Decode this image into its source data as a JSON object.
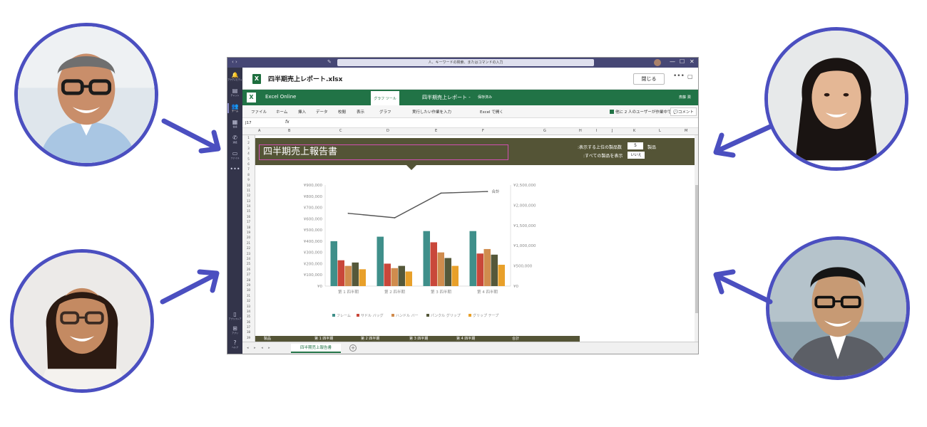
{
  "colors": {
    "teams_purple": "#464775",
    "excel_green": "#217346",
    "banner": "#545436",
    "ring": "#4b4fc0"
  },
  "titlebar": {
    "search_placeholder": "人、キーワードの検索、またはコマンドの入力",
    "nav": "‹ ›",
    "compose": "✎",
    "min": "—",
    "max": "☐",
    "close": "✕"
  },
  "rail": [
    {
      "icon": "bell-icon",
      "glyph": "🔔",
      "label": "アクティビティ"
    },
    {
      "icon": "chat-icon",
      "glyph": "▤",
      "label": "チャット"
    },
    {
      "icon": "teams-icon",
      "glyph": "👥",
      "label": "チーム",
      "active": true
    },
    {
      "icon": "calendar-icon",
      "glyph": "▦",
      "label": "会議"
    },
    {
      "icon": "phone-icon",
      "glyph": "✆",
      "label": "通話"
    },
    {
      "icon": "file-icon",
      "glyph": "▭",
      "label": "ファイル"
    },
    {
      "icon": "more-icon",
      "glyph": "•••",
      "label": ""
    }
  ],
  "rail_bottom": [
    {
      "icon": "store-icon",
      "glyph": "▯",
      "label": "アプリストア"
    },
    {
      "icon": "apps-icon",
      "glyph": "⊞",
      "label": "アプリ"
    },
    {
      "icon": "help-icon",
      "glyph": "?",
      "label": "ヘルプ"
    }
  ],
  "file": {
    "name": "四半期売上レポート.xlsx",
    "close_label": "閉じる",
    "more": "•••",
    "chat": "▢"
  },
  "excel_bar": {
    "icon": "X",
    "brand": "Excel Online",
    "chart_tools": "グラフ ツール",
    "doc_title": "四半期売上レポート  -",
    "saved": "保存済み",
    "user": "斎藤 潤"
  },
  "ribbon": {
    "tabs": [
      "ファイル",
      "ホーム",
      "挿入",
      "データ",
      "校閲",
      "表示",
      "グラフ"
    ],
    "tell_me": "実行したい作業を入力",
    "open_excel": "Excel で開く",
    "coedit": "他に 2 人のユーザーが作業中です ▾",
    "comment": "💬コメント"
  },
  "formula": {
    "cellref": "J17",
    "fx": "fx"
  },
  "columns": [
    "A",
    "B",
    "C",
    "D",
    "E",
    "F",
    "G",
    "H",
    "I",
    "J",
    "K",
    "L",
    "M"
  ],
  "rows": [
    "1",
    "2",
    "3",
    "4",
    "5",
    "6",
    "7",
    "8",
    "9",
    "10",
    "11",
    "12",
    "13",
    "14",
    "15",
    "16",
    "17",
    "18",
    "19",
    "20",
    "21",
    "22",
    "23",
    "24",
    "25",
    "26",
    "27",
    "28",
    "29",
    "30",
    "31",
    "32",
    "33",
    "34",
    "35",
    "36",
    "37",
    "38",
    "39"
  ],
  "report": {
    "title": "四半期売上報告書",
    "top_label": ":表示する上位の製品数",
    "top_value": "5",
    "top_unit": "製品",
    "all_label": ":すべての製品を表示",
    "all_value": "いいえ"
  },
  "chart_data": {
    "type": "bar",
    "categories": [
      "第 1 四半期",
      "第 2 四半期",
      "第 3 四半期",
      "第 4 四半期"
    ],
    "series": [
      {
        "name": "フレーム",
        "color": "#3f8f8a",
        "values": [
          400000,
          440000,
          490000,
          490000
        ]
      },
      {
        "name": "サドル バッグ",
        "color": "#c9473a",
        "values": [
          230000,
          200000,
          390000,
          290000
        ]
      },
      {
        "name": "ハンドル バー",
        "color": "#d08c4e",
        "values": [
          180000,
          160000,
          300000,
          330000
        ]
      },
      {
        "name": "パンクル グリップ",
        "color": "#55583a",
        "values": [
          210000,
          180000,
          250000,
          280000
        ]
      },
      {
        "name": "グリップ テープ",
        "color": "#e8a02a",
        "values": [
          150000,
          130000,
          180000,
          190000
        ]
      }
    ],
    "line": {
      "name": "合計",
      "values": [
        1800000,
        1690000,
        2300000,
        2340000
      ]
    },
    "yticks_left": [
      "¥900,000",
      "¥800,000",
      "¥700,000",
      "¥600,000",
      "¥500,000",
      "¥400,000",
      "¥300,000",
      "¥200,000",
      "¥100,000",
      "¥0"
    ],
    "yticks_right": [
      "¥2,500,000",
      "¥2,000,000",
      "¥1,500,000",
      "¥1,000,000",
      "¥500,000",
      "¥0"
    ],
    "ylim_left": [
      0,
      900000
    ],
    "ylim_right": [
      0,
      2500000
    ],
    "legend_position": "bottom"
  },
  "table_header": [
    "製品",
    "第 1 四半期",
    "第 2 四半期",
    "第 3 四半期",
    "第 4 四半期",
    "合計"
  ],
  "sheet_tab": "四半期売上報告書",
  "sheet_nav": "◂ ▸ ◂ ▸",
  "add_sheet": "+"
}
